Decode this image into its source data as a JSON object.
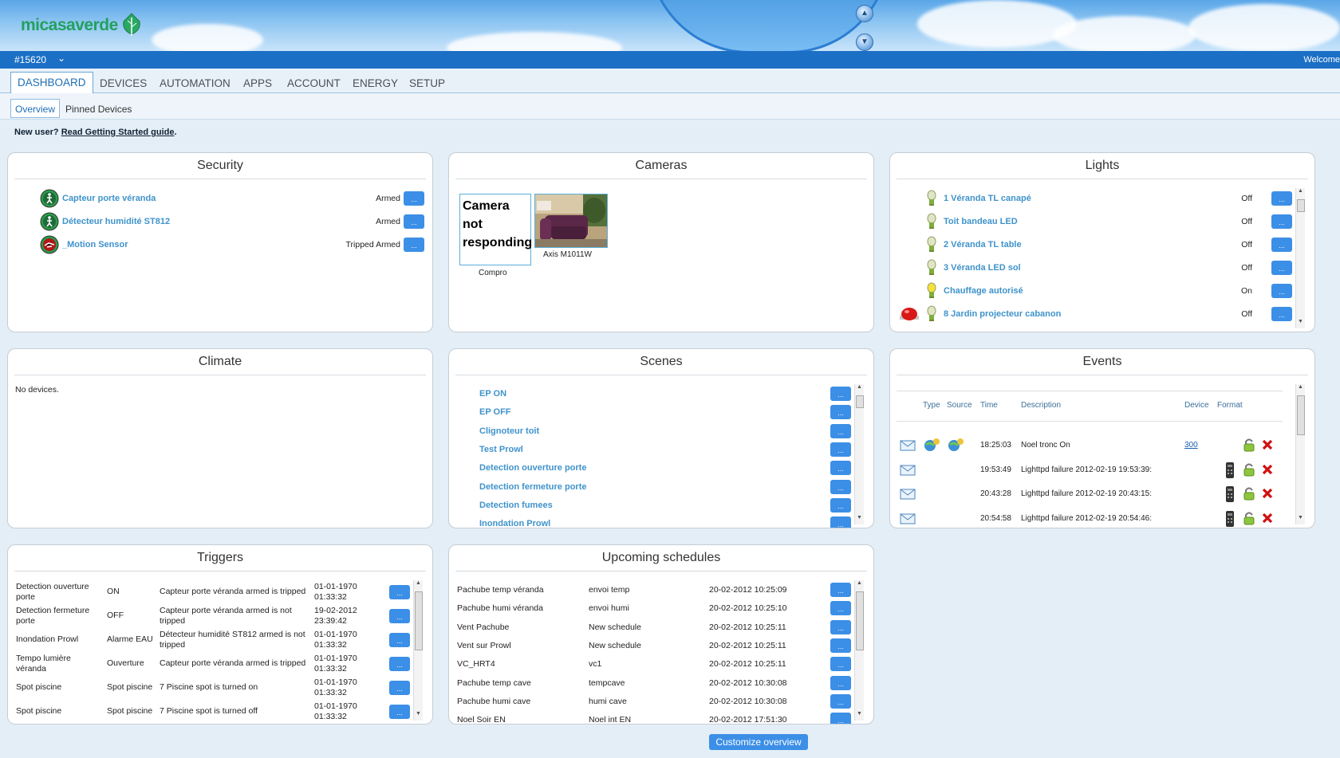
{
  "brand": {
    "logo_text": "micasaverde"
  },
  "topbar": {
    "account": "#15620",
    "welcome": "Welcome"
  },
  "nav": {
    "tabs": [
      "DASHBOARD",
      "DEVICES",
      "AUTOMATION",
      "APPS",
      "ACCOUNT",
      "ENERGY",
      "SETUP"
    ]
  },
  "subnav": {
    "tabs": [
      "Overview",
      "Pinned Devices"
    ]
  },
  "notice": {
    "text": "New user?",
    "link": "Read Getting Started guide",
    "suffix": "."
  },
  "btn_label": "...",
  "security": {
    "title": "Security",
    "items": [
      {
        "name": "Capteur porte véranda",
        "status": "Armed"
      },
      {
        "name": "Détecteur humidité ST812",
        "status": "Armed"
      },
      {
        "name": "_Motion Sensor",
        "status": "Tripped Armed"
      }
    ]
  },
  "cameras": {
    "title": "Cameras",
    "items": [
      {
        "name": "Compro",
        "image_text": "Camera not responding"
      },
      {
        "name": "Axis M1011W"
      }
    ]
  },
  "lights": {
    "title": "Lights",
    "items": [
      {
        "name": "1 Véranda TL canapé",
        "status": "Off"
      },
      {
        "name": "Toit bandeau LED",
        "status": "Off"
      },
      {
        "name": "2 Véranda TL table",
        "status": "Off"
      },
      {
        "name": "3 Véranda LED sol",
        "status": "Off"
      },
      {
        "name": "Chauffage autorisé",
        "status": "On"
      },
      {
        "name": "8 Jardin projecteur cabanon",
        "status": "Off"
      }
    ]
  },
  "climate": {
    "title": "Climate",
    "empty": "No devices."
  },
  "scenes": {
    "title": "Scenes",
    "items": [
      "EP ON",
      "EP OFF",
      "Clignoteur toit",
      "Test Prowl",
      "Detection ouverture porte",
      "Detection fermeture porte",
      "Detection fumees",
      "Inondation Prowl"
    ]
  },
  "events": {
    "title": "Events",
    "headers": {
      "type": "Type",
      "source": "Source",
      "time": "Time",
      "description": "Description",
      "device": "Device",
      "format": "Format"
    },
    "rows": [
      {
        "time": "18:25:03",
        "description": "Noel tronc On",
        "device": "300"
      },
      {
        "time": "19:53:49",
        "description": "Lighttpd failure 2012-02-19 19:53:39:"
      },
      {
        "time": "20:43:28",
        "description": "Lighttpd failure 2012-02-19 20:43:15:"
      },
      {
        "time": "20:54:58",
        "description": "Lighttpd failure 2012-02-19 20:54:46:"
      }
    ]
  },
  "triggers": {
    "title": "Triggers",
    "rows": [
      {
        "name": "Detection ouverture porte",
        "scene": "ON",
        "desc": "Capteur porte véranda armed is tripped",
        "date": "01-01-1970",
        "time": "01:33:32"
      },
      {
        "name": "Detection fermeture porte",
        "scene": "OFF",
        "desc": "Capteur porte véranda armed is not tripped",
        "date": "19-02-2012",
        "time": "23:39:42"
      },
      {
        "name": "Inondation Prowl",
        "scene": "Alarme EAU",
        "desc": "Détecteur humidité ST812 armed is not tripped",
        "date": "01-01-1970",
        "time": "01:33:32"
      },
      {
        "name": "Tempo lumière véranda",
        "scene": "Ouverture",
        "desc": "Capteur porte véranda armed is tripped",
        "date": "01-01-1970",
        "time": "01:33:32"
      },
      {
        "name": "Spot piscine",
        "scene": "Spot piscine",
        "desc": "7 Piscine spot is turned on",
        "date": "01-01-1970",
        "time": "01:33:32"
      },
      {
        "name": "Spot piscine",
        "scene": "Spot piscine",
        "desc": "7 Piscine spot is turned off",
        "date": "01-01-1970",
        "time": "01:33:32"
      }
    ]
  },
  "schedules": {
    "title": "Upcoming schedules",
    "rows": [
      {
        "scene": "Pachube temp véranda",
        "name": "envoi temp",
        "datetime": "20-02-2012 10:25:09"
      },
      {
        "scene": "Pachube humi véranda",
        "name": "envoi humi",
        "datetime": "20-02-2012 10:25:10"
      },
      {
        "scene": "Vent Pachube",
        "name": "New schedule",
        "datetime": "20-02-2012 10:25:11"
      },
      {
        "scene": "Vent sur Prowl",
        "name": "New schedule",
        "datetime": "20-02-2012 10:25:11"
      },
      {
        "scene": "VC_HRT4",
        "name": "vc1",
        "datetime": "20-02-2012 10:25:11"
      },
      {
        "scene": "Pachube temp cave",
        "name": "tempcave",
        "datetime": "20-02-2012 10:30:08"
      },
      {
        "scene": "Pachube humi cave",
        "name": "humi cave",
        "datetime": "20-02-2012 10:30:08"
      },
      {
        "scene": "Noel Soir EN",
        "name": "Noel int EN",
        "datetime": "20-02-2012 17:51:30"
      }
    ]
  },
  "footer": {
    "customize": "Customize overview"
  }
}
